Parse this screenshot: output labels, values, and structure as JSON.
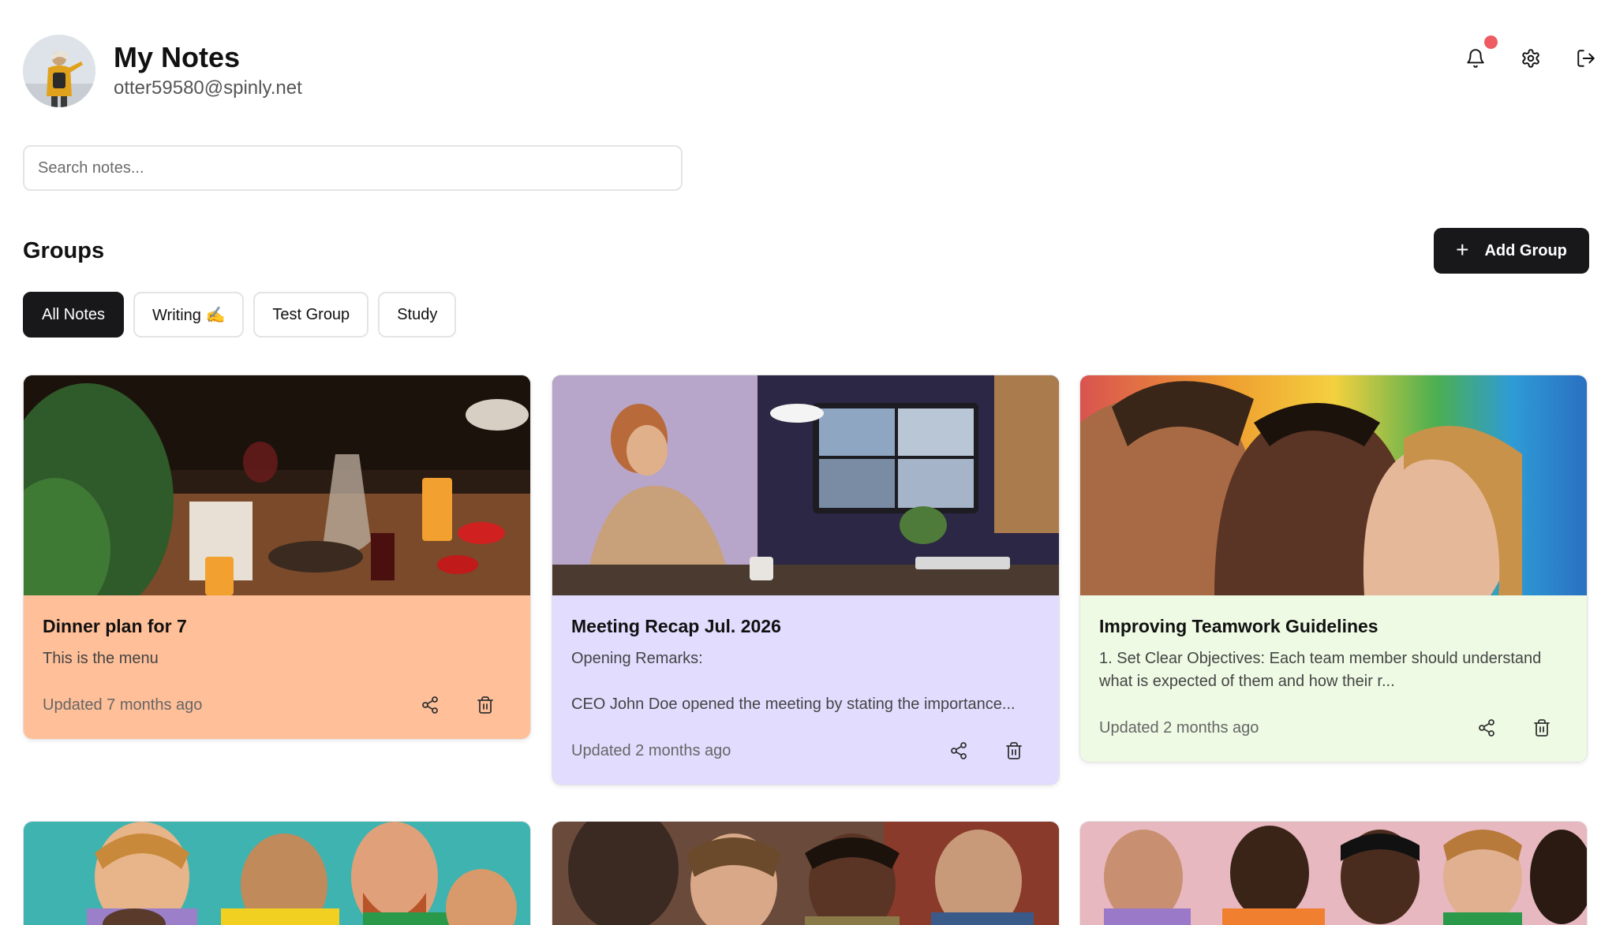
{
  "header": {
    "title": "My Notes",
    "email": "otter59580@spinly.net",
    "avatar_icon": "user-avatar",
    "actions": [
      {
        "name": "bell-icon",
        "has_notification": true
      },
      {
        "name": "gear-icon"
      },
      {
        "name": "logout-icon"
      }
    ]
  },
  "search": {
    "placeholder": "Search notes...",
    "value": ""
  },
  "groups": {
    "title": "Groups",
    "add_label": "Add Group",
    "chips": [
      {
        "label": "All Notes",
        "active": true
      },
      {
        "label": "Writing ✍️",
        "active": false
      },
      {
        "label": "Test Group",
        "active": false
      },
      {
        "label": "Study",
        "active": false
      }
    ]
  },
  "notes": [
    {
      "title": "Dinner plan for 7",
      "description": "This is the menu",
      "updated": "Updated 7 months ago",
      "color": "#ffbf98",
      "image": "dinner-table-photo"
    },
    {
      "title": "Meeting Recap Jul. 2026",
      "description": "Opening Remarks:\n\nCEO John Doe opened the meeting by stating the importance...",
      "updated": "Updated 2 months ago",
      "color": "#e2dcff",
      "image": "video-call-photo"
    },
    {
      "title": "Improving Teamwork Guidelines",
      "description": "1. Set Clear Objectives: Each team member should understand what is expected of them and how their r...",
      "updated": "Updated 2 months ago",
      "color": "#eefae4",
      "image": "team-profiles-photo"
    }
  ],
  "more_notes_images": [
    "smiling-group-photo",
    "students-library-photo",
    "students-table-photo"
  ],
  "colors": {
    "accent_dark": "#18181b",
    "notification": "#ef5b63",
    "border": "#e4e4e7"
  }
}
